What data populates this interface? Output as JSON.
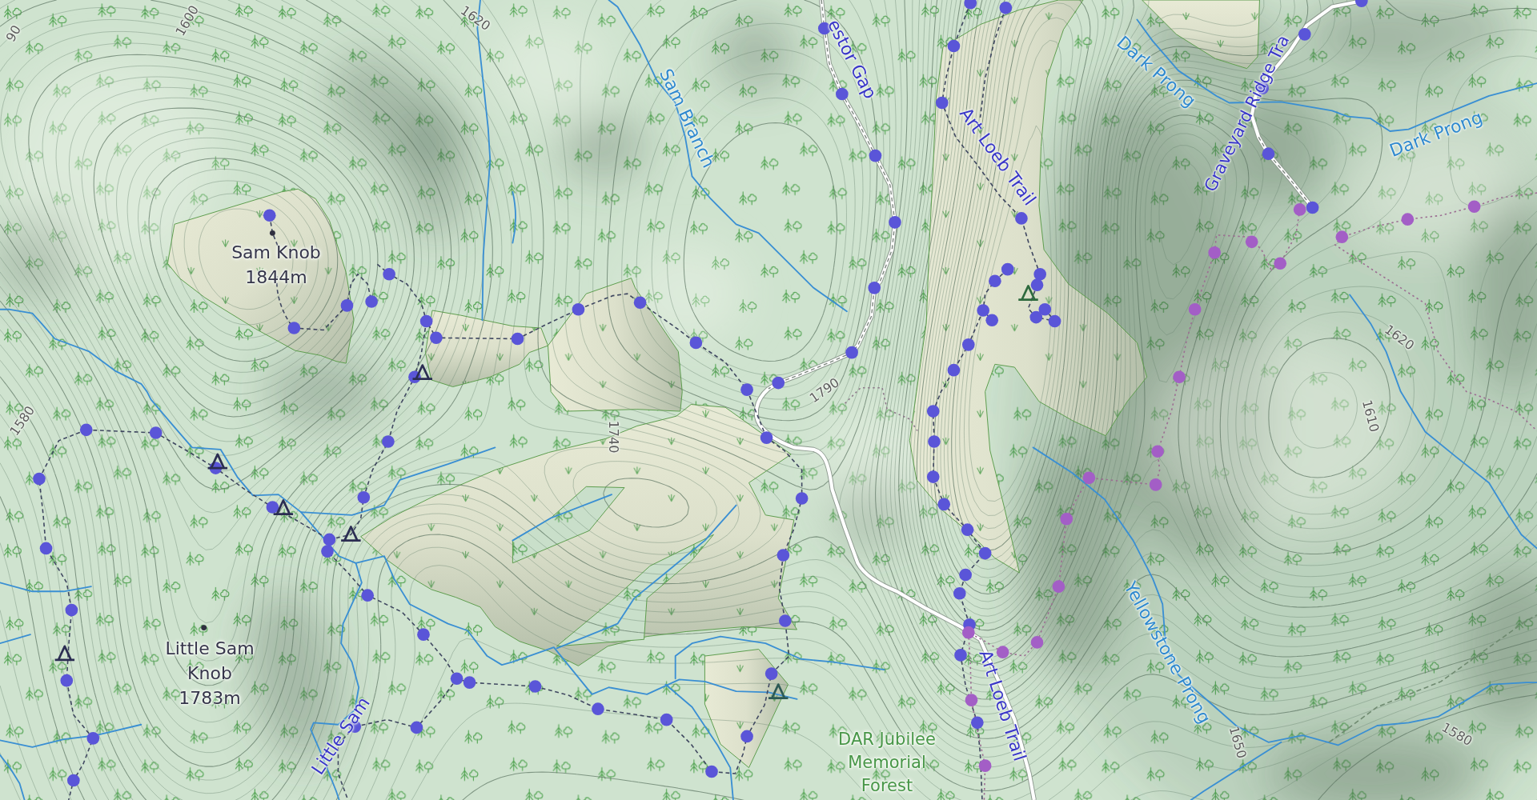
{
  "map": {
    "routes": [
      {
        "color": "#5a55d8"
      },
      {
        "color": "#a35ec6"
      }
    ],
    "peaks": [
      {
        "name": "Sam Knob",
        "elevation": "1844m"
      },
      {
        "name": "Little Sam Knob",
        "elevation": "1783m"
      }
    ],
    "waterways": [
      {
        "name": "Sam Branch"
      },
      {
        "name": "Dark Prong"
      },
      {
        "name": "Dark Prong"
      },
      {
        "name": "Yellowstone Prong"
      }
    ],
    "trail_labels": [
      {
        "name": "estor Gap"
      },
      {
        "name": "Art Loeb Trail"
      },
      {
        "name": "Graveyard Ridge Tra"
      },
      {
        "name": "Little Sam"
      },
      {
        "name": "Art Loeb Trail"
      }
    ],
    "area_labels": [
      {
        "name": "DAR Jubilee Memorial Forest"
      }
    ],
    "contour_labels": [
      "90",
      "1600",
      "1620",
      "1580",
      "1740",
      "1790",
      "1620",
      "1610",
      "1650",
      "1580"
    ]
  }
}
